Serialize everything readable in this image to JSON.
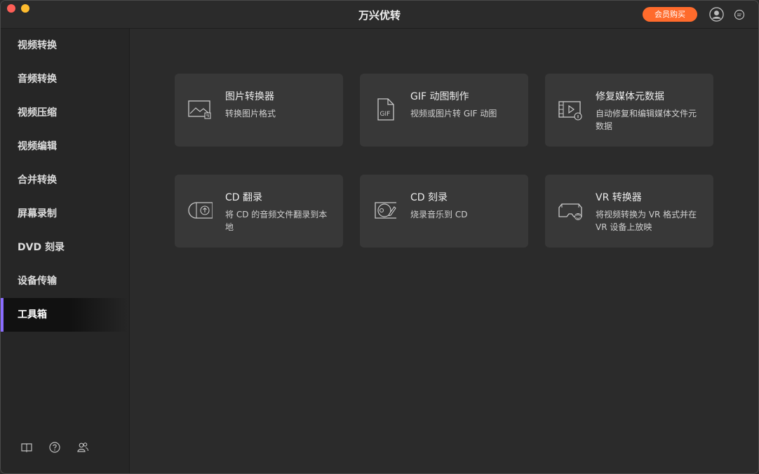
{
  "app": {
    "title": "万兴优转",
    "buy_label": "会员购买"
  },
  "sidebar": {
    "items": [
      {
        "label": "视频转换"
      },
      {
        "label": "音频转换"
      },
      {
        "label": "视频压缩"
      },
      {
        "label": "视频编辑"
      },
      {
        "label": "合并转换"
      },
      {
        "label": "屏幕录制"
      },
      {
        "label": "DVD 刻录"
      },
      {
        "label": "设备传输"
      },
      {
        "label": "工具箱",
        "active": true
      }
    ],
    "footer_icons": [
      "book-icon",
      "help-icon",
      "users-icon"
    ]
  },
  "tools": [
    {
      "title": "图片转换器",
      "desc": "转换图片格式",
      "icon": "image-convert-icon"
    },
    {
      "title": "GIF 动图制作",
      "desc": "视频或图片转 GIF 动图",
      "icon": "gif-file-icon"
    },
    {
      "title": "修复媒体元数据",
      "desc": "自动修复和编辑媒体文件元数据",
      "icon": "media-metadata-icon"
    },
    {
      "title": "CD 翻录",
      "desc": "将 CD 的音频文件翻录到本地",
      "icon": "cd-rip-icon"
    },
    {
      "title": "CD 刻录",
      "desc": "烧录音乐到 CD",
      "icon": "cd-burn-icon"
    },
    {
      "title": "VR 转换器",
      "desc": "将视频转换为 VR 格式并在 VR 设备上放映",
      "icon": "vr-headset-icon"
    }
  ],
  "colors": {
    "accent": "#8a6cff",
    "buy": "#ff6b2c",
    "card": "#383838",
    "bg": "#2b2b2b"
  }
}
